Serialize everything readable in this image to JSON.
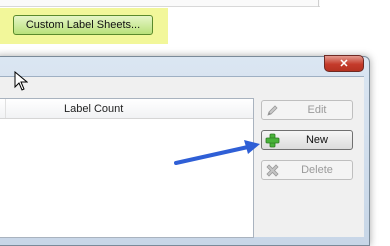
{
  "toolbar": {
    "custom_label_sheets_button": "Custom Label Sheets..."
  },
  "dialog": {
    "close_glyph": "✕",
    "list": {
      "columns": [
        "Label Count"
      ]
    },
    "buttons": {
      "edit": "Edit",
      "new": "New",
      "delete": "Delete"
    }
  },
  "colors": {
    "highlight": "#f2f79a",
    "button_green": "#b9e17a",
    "arrow_blue": "#2f5fd6",
    "close_red": "#c43b2b"
  },
  "icons": {
    "edit": "pencil-icon",
    "new": "plus-icon",
    "delete": "x-icon",
    "cursor": "cursor-icon",
    "annotation": "arrow-icon"
  }
}
